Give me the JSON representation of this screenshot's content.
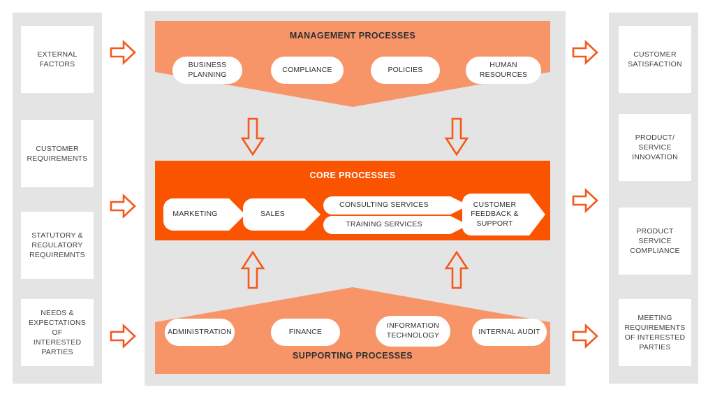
{
  "colors": {
    "panel_gray": "#e4e4e4",
    "band_light_orange": "#F79569",
    "band_core_orange": "#FA5400",
    "arrow_outline": "#F4581C",
    "box_white": "#ffffff",
    "text_dark": "#3c3c3c"
  },
  "inputs": {
    "items": [
      {
        "label": "EXTERNAL\nFACTORS"
      },
      {
        "label": "CUSTOMER\nREQUIREMENTS"
      },
      {
        "label": "STATUTORY &\nREGULATORY\nREQUIREMNTS"
      },
      {
        "label": "NEEDS &\nEXPECTATIONS OF\nINTERESTED\nPARTIES"
      }
    ]
  },
  "outputs": {
    "items": [
      {
        "label": "CUSTOMER\nSATISFACTION"
      },
      {
        "label": "PRODUCT/\nSERVICE\nINNOVATION"
      },
      {
        "label": "PRODUCT SERVICE\nCOMPLIANCE"
      },
      {
        "label": "MEETING\nREQUIREMENTS\nOF INTERESTED\nPARTIES"
      }
    ]
  },
  "management": {
    "title": "MANAGEMENT PROCESSES",
    "items": [
      {
        "label": "BUSINESS\nPLANNING"
      },
      {
        "label": "COMPLIANCE"
      },
      {
        "label": "POLICIES"
      },
      {
        "label": "HUMAN\nRESOURCES"
      }
    ]
  },
  "core": {
    "title": "CORE PROCESSES",
    "items": [
      {
        "label": "MARKETING"
      },
      {
        "label": "SALES"
      },
      {
        "label": "CONSULTING  SERVICES"
      },
      {
        "label": "TRAINING  SERVICES"
      },
      {
        "label": "CUSTOMER\nFEEDBACK &\nSUPPORT"
      }
    ]
  },
  "supporting": {
    "title": "SUPPORTING PROCESSES",
    "items": [
      {
        "label": "ADMINISTRATION"
      },
      {
        "label": "FINANCE"
      },
      {
        "label": "INFORMATION\nTECHNOLOGY"
      },
      {
        "label": "INTERNAL AUDIT"
      }
    ]
  },
  "flow_arrows": {
    "input_arrows": [
      {
        "name": "input-arrow-1",
        "direction": "right"
      },
      {
        "name": "input-arrow-2",
        "direction": "right"
      },
      {
        "name": "input-arrow-3",
        "direction": "right"
      }
    ],
    "output_arrows": [
      {
        "name": "output-arrow-1",
        "direction": "right"
      },
      {
        "name": "output-arrow-2",
        "direction": "right"
      },
      {
        "name": "output-arrow-3",
        "direction": "right"
      }
    ],
    "down_arrows": [
      {
        "name": "management-to-core-arrow-left",
        "direction": "down"
      },
      {
        "name": "management-to-core-arrow-right",
        "direction": "down"
      }
    ],
    "up_arrows": [
      {
        "name": "supporting-to-core-arrow-left",
        "direction": "up"
      },
      {
        "name": "supporting-to-core-arrow-right",
        "direction": "up"
      }
    ]
  }
}
